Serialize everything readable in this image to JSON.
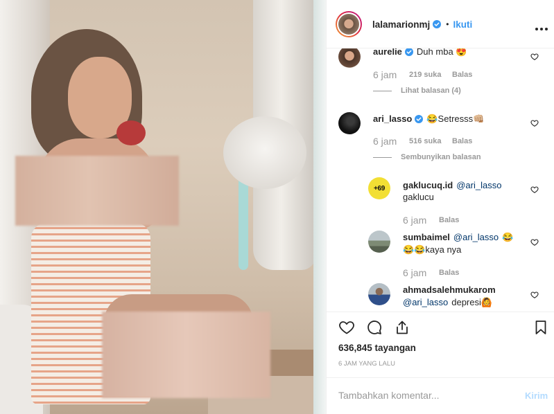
{
  "header": {
    "username": "lalamarionmj",
    "verified": true,
    "separator": "•",
    "follow_label": "Ikuti"
  },
  "comments": [
    {
      "username": "aurelie",
      "verified": true,
      "text": "Duh mba 😍",
      "time": "6 jam",
      "likes": "219 suka",
      "reply_label": "Balas",
      "replies_toggle": "Lihat balasan (4)"
    },
    {
      "username": "ari_lasso",
      "verified": true,
      "text": "😂Setresss👊🏼",
      "time": "6 jam",
      "likes": "516 suka",
      "reply_label": "Balas",
      "replies_toggle": "Sembunyikan balasan",
      "replies": [
        {
          "username": "gaklucuq.id",
          "avatar_text": "+69",
          "mention": "@ari_lasso",
          "text": "gaklucu",
          "time": "6 jam",
          "reply_label": "Balas"
        },
        {
          "username": "sumbaimel",
          "mention": "@ari_lasso",
          "text_inline": "😂",
          "text": "😂😂kaya nya",
          "time": "6 jam",
          "reply_label": "Balas"
        },
        {
          "username": "ahmadsalehmukarom",
          "mention": "@ari_lasso",
          "text": "depresi🙆"
        }
      ]
    }
  ],
  "views": "636,845 tayangan",
  "posted_time": "6 JAM YANG LALU",
  "add_comment": {
    "placeholder": "Tambahkan komentar...",
    "submit_label": "Kirim"
  },
  "icons": {
    "more": "more-horizontal-icon",
    "verified": "verified-badge-icon",
    "comment_like": "heart-icon",
    "like": "heart-icon",
    "comment": "comment-icon",
    "share": "share-icon",
    "save": "bookmark-icon"
  },
  "colors": {
    "link_blue": "#3897f0",
    "mention_blue": "#003569",
    "submit_disabled": "#b3dbff",
    "text": "#262626",
    "muted": "#999999",
    "border": "#efefef",
    "story_ring": [
      "#f09433",
      "#dc2743",
      "#bc1888"
    ]
  }
}
